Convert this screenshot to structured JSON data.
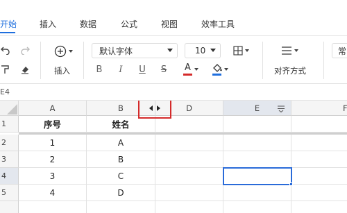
{
  "tabs": [
    {
      "label": "开始",
      "active": true
    },
    {
      "label": "插入",
      "active": false
    },
    {
      "label": "数据",
      "active": false
    },
    {
      "label": "公式",
      "active": false
    },
    {
      "label": "视图",
      "active": false
    },
    {
      "label": "效率工具",
      "active": false
    }
  ],
  "ribbon": {
    "insert_label": "插入",
    "font_family": "默认字体",
    "font_size": "10",
    "align_label": "对齐方式",
    "format_partial": "常",
    "bold": "B",
    "italic": "I",
    "underline": "U",
    "strike": "S",
    "font_color_letter": "A",
    "font_color": "#d42a2a",
    "fill_color": "#1f6fde"
  },
  "name_box": "E4",
  "columns": [
    "A",
    "B",
    "D",
    "E",
    "F"
  ],
  "rows": [
    "1",
    "2",
    "3",
    "4",
    "5"
  ],
  "cells": [
    [
      "序号",
      "姓名"
    ],
    [
      "1",
      "A"
    ],
    [
      "2",
      "B"
    ],
    [
      "3",
      "C"
    ],
    [
      "4",
      "D"
    ]
  ],
  "selected_cell": "E4",
  "accent_color": "#1f6fde",
  "highlight_color": "#d42a2a"
}
